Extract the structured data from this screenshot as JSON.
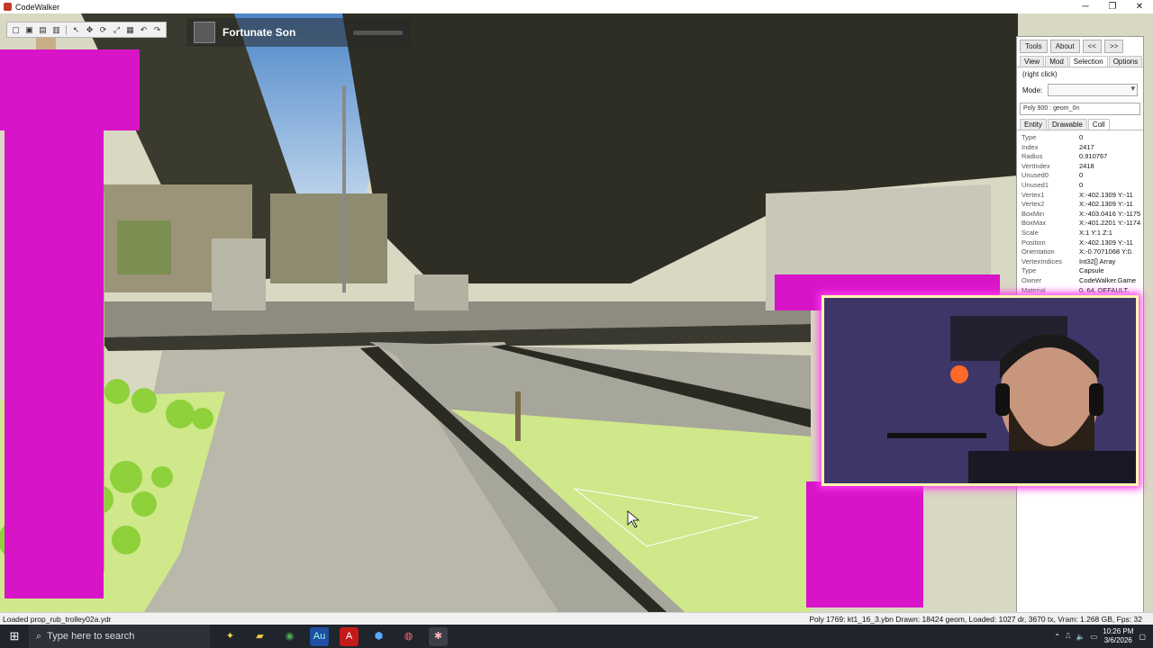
{
  "window": {
    "title": "CodeWalker",
    "min_icon": "minimize-icon",
    "max_icon": "maximize-icon",
    "close_icon": "close-icon"
  },
  "media": {
    "song_title": "Fortunate Son",
    "progress": 0.45
  },
  "panel": {
    "buttons": {
      "tools": "Tools",
      "about": "About",
      "collapse": "<<",
      "expand": ">>"
    },
    "tabs": [
      "View",
      "Mod",
      "Selection",
      "Options"
    ],
    "hint": "(right click)",
    "mode_label": "Mode:",
    "selection_field": "Poly 900 : geom_0n",
    "subtabs": [
      "Entity",
      "Drawable",
      "Coll"
    ],
    "properties": [
      {
        "k": "Type",
        "v": "0"
      },
      {
        "k": "Index",
        "v": "2417"
      },
      {
        "k": "Radius",
        "v": "0.910767"
      },
      {
        "k": "VertIndex",
        "v": "2418"
      },
      {
        "k": "Unused0",
        "v": "0"
      },
      {
        "k": "Unused1",
        "v": "0"
      },
      {
        "k": "Vertex1",
        "v": "X:-402.1309 Y:-11"
      },
      {
        "k": "Vertex2",
        "v": "X:-402.1309 Y:-11"
      },
      {
        "k": "BoxMin",
        "v": "X:-403.0416 Y:-1175."
      },
      {
        "k": "BoxMax",
        "v": "X:-401.2201 Y:-1174."
      },
      {
        "k": "Scale",
        "v": "X:1 Y:1 Z:1"
      },
      {
        "k": "Position",
        "v": "X:-402.1309 Y:-11"
      },
      {
        "k": "Orientation",
        "v": "X:-0.7071068 Y:0."
      },
      {
        "k": "VertexIndices",
        "v": "Int32[] Array"
      },
      {
        "k": "Type",
        "v": "Capsule"
      },
      {
        "k": "Owner",
        "v": "CodeWalker.Game"
      },
      {
        "k": "Material",
        "v": "0, 64, DEFAULT,"
      }
    ]
  },
  "status": {
    "left": "Loaded prop_rub_trolley02a.ydr",
    "right": "Poly 1769: kt1_16_3.ybn  Drawn: 18424 geom, Loaded: 1027 dr, 3670 tx, Vram: 1.268 GB, Fps: 32"
  },
  "taskbar": {
    "search_placeholder": "Type here to search",
    "time": "10:26 PM",
    "date": "3/6/2026"
  }
}
